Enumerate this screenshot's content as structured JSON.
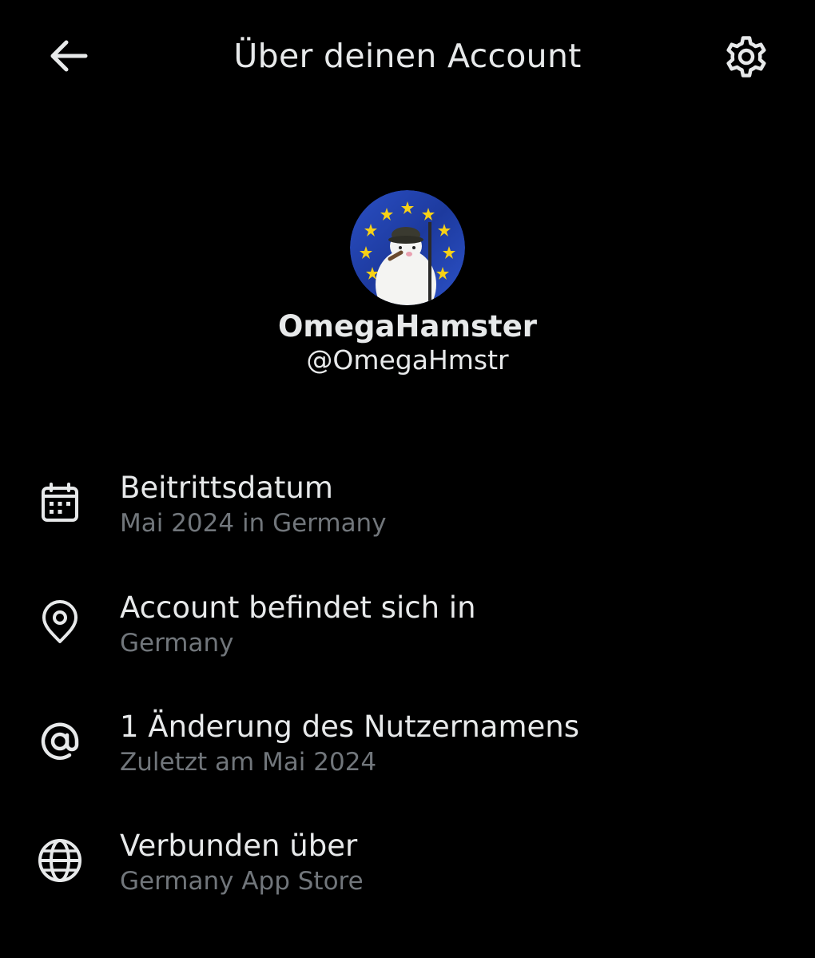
{
  "header": {
    "title": "Über deinen Account",
    "back_icon": "arrow-left-icon",
    "settings_icon": "gear-icon"
  },
  "profile": {
    "display_name": "OmegaHamster",
    "handle": "@OmegaHmstr",
    "avatar_description_colors": {
      "flag_blue": "#1f3fa8",
      "star_yellow": "#f7d117"
    }
  },
  "info_items": [
    {
      "icon": "calendar-icon",
      "label": "Beitrittsdatum",
      "value": "Mai 2024 in Germany"
    },
    {
      "icon": "location-pin-icon",
      "label": "Account befindet sich in",
      "value": "Germany"
    },
    {
      "icon": "at-sign-icon",
      "label": "1 Änderung des Nutzernamens",
      "value": "Zuletzt am Mai 2024"
    },
    {
      "icon": "globe-icon",
      "label": "Verbunden über",
      "value": "Germany App Store"
    }
  ],
  "colors": {
    "background": "#000000",
    "primary_text": "#e7e9ea",
    "secondary_text": "#71767b"
  }
}
